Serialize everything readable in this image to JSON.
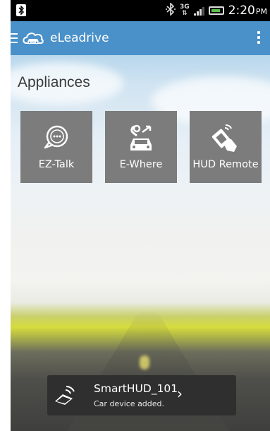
{
  "status_bar": {
    "time": "2:20",
    "ampm": "PM",
    "network_top": "3G",
    "network_bottom": "⇅",
    "bluetooth_glyph": "✻",
    "icons": [
      "bluetooth-icon",
      "bluetooth-notification-icon",
      "3g-icon",
      "signal-icon",
      "battery-icon"
    ]
  },
  "app_bar": {
    "title": "eLeadrive",
    "icons": [
      "menu-icon",
      "car-cloud-logo-icon",
      "overflow-menu-icon"
    ]
  },
  "main": {
    "section_title": "Appliances",
    "tiles": [
      {
        "label": "EZ-Talk",
        "icon": "chat-bubble-icon"
      },
      {
        "label": "E-Where",
        "icon": "car-location-icon"
      },
      {
        "label": "HUD Remote",
        "icon": "hud-remote-icon"
      }
    ]
  },
  "toast": {
    "title": "SmartHUD_101",
    "chevron": "›",
    "subtitle": "Car device added.",
    "icon": "hud-device-icon"
  },
  "colors": {
    "app_bar": "#4a90c9",
    "tile": "#7c7c7c",
    "toast": "#2f2f2f",
    "status_bar": "#000000"
  }
}
